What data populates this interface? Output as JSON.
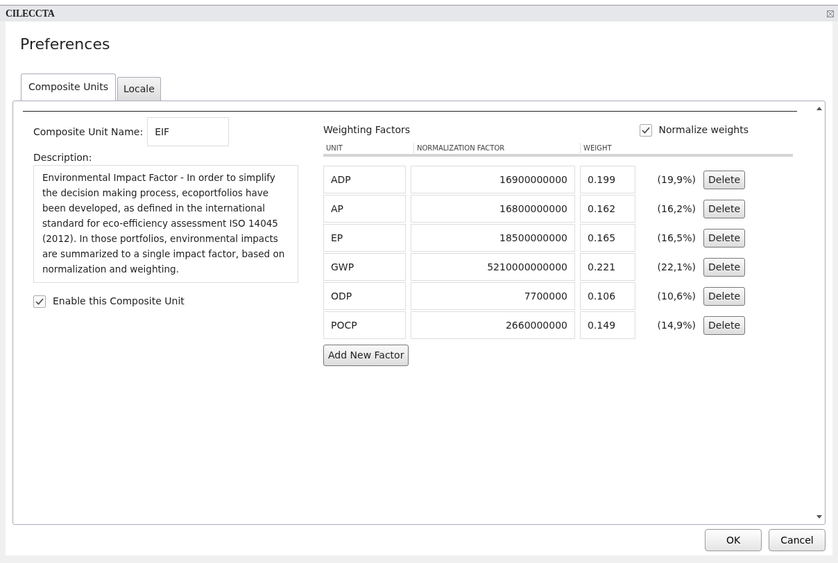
{
  "window": {
    "title": "CILECCTA"
  },
  "heading": "Preferences",
  "tabs": [
    {
      "label": "Composite Units",
      "selected": true
    },
    {
      "label": "Locale",
      "selected": false
    }
  ],
  "unit_name": {
    "label": "Composite Unit Name:",
    "value": "EIF"
  },
  "description": {
    "label": "Description:",
    "value": "Environmental Impact Factor - In order to simplify the decision making process, ecoportfolios have been developed, as defined in the international standard for eco-efficiency assessment ISO 14045 (2012). In those portfolios, environmental impacts are summarized to a single impact factor, based on normalization and weighting."
  },
  "enable": {
    "label": "Enable this Composite Unit",
    "checked": true
  },
  "weighting": {
    "title": "Weighting Factors",
    "normalize": {
      "label": "Normalize weights",
      "checked": true
    },
    "columns": [
      "UNIT",
      "NORMALIZATION FACTOR",
      "WEIGHT"
    ],
    "rows": [
      {
        "unit": "ADP",
        "factor": "16900000000",
        "weight": "0.199",
        "share": "(19,9%)",
        "action": "Delete"
      },
      {
        "unit": "AP",
        "factor": "16800000000",
        "weight": "0.162",
        "share": "(16,2%)",
        "action": "Delete"
      },
      {
        "unit": "EP",
        "factor": "18500000000",
        "weight": "0.165",
        "share": "(16,5%)",
        "action": "Delete"
      },
      {
        "unit": "GWP",
        "factor": "5210000000000",
        "weight": "0.221",
        "share": "(22,1%)",
        "action": "Delete"
      },
      {
        "unit": "ODP",
        "factor": "7700000",
        "weight": "0.106",
        "share": "(10,6%)",
        "action": "Delete"
      },
      {
        "unit": "POCP",
        "factor": "2660000000",
        "weight": "0.149",
        "share": "(14,9%)",
        "action": "Delete"
      }
    ],
    "add_button": "Add New Factor"
  },
  "buttons": [
    "OK",
    "Cancel"
  ]
}
